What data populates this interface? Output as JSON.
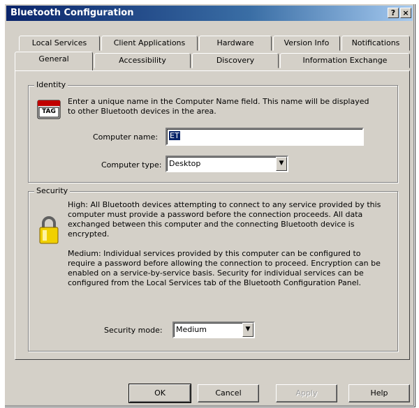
{
  "window": {
    "title": "Bluetooth Configuration",
    "help_glyph": "?",
    "close_glyph": "×"
  },
  "tabs": {
    "back_row": [
      "Local Services",
      "Client Applications",
      "Hardware",
      "Version Info",
      "Notifications"
    ],
    "front_row": [
      "General",
      "Accessibility",
      "Discovery",
      "Information Exchange"
    ],
    "active": "General"
  },
  "identity": {
    "group_label": "Identity",
    "icon_text": "TAG",
    "description": "Enter a unique name in the Computer Name field. This name will be displayed to other Bluetooth devices in the area.",
    "computer_name_label": "Computer name:",
    "computer_name_value": "ET",
    "computer_type_label": "Computer type:",
    "computer_type_value": "Desktop"
  },
  "security": {
    "group_label": "Security",
    "high_text": "High: All Bluetooth devices attempting to connect to any service provided by this computer must provide a password before the connection proceeds. All data exchanged between this computer and the connecting Bluetooth device is encrypted.",
    "medium_text": "Medium: Individual services provided by this computer can be configured to require a password before allowing the connection to proceed. Encryption can be enabled on a service-by-service basis. Security for individual services can be configured from the Local Services tab of the Bluetooth Configuration Panel.",
    "mode_label": "Security mode:",
    "mode_value": "Medium"
  },
  "buttons": {
    "ok": "OK",
    "cancel": "Cancel",
    "apply": "Apply",
    "help": "Help"
  },
  "colors": {
    "face": "#d4d0c8",
    "titlebar": "#0a246a",
    "selection": "#0a246a"
  }
}
